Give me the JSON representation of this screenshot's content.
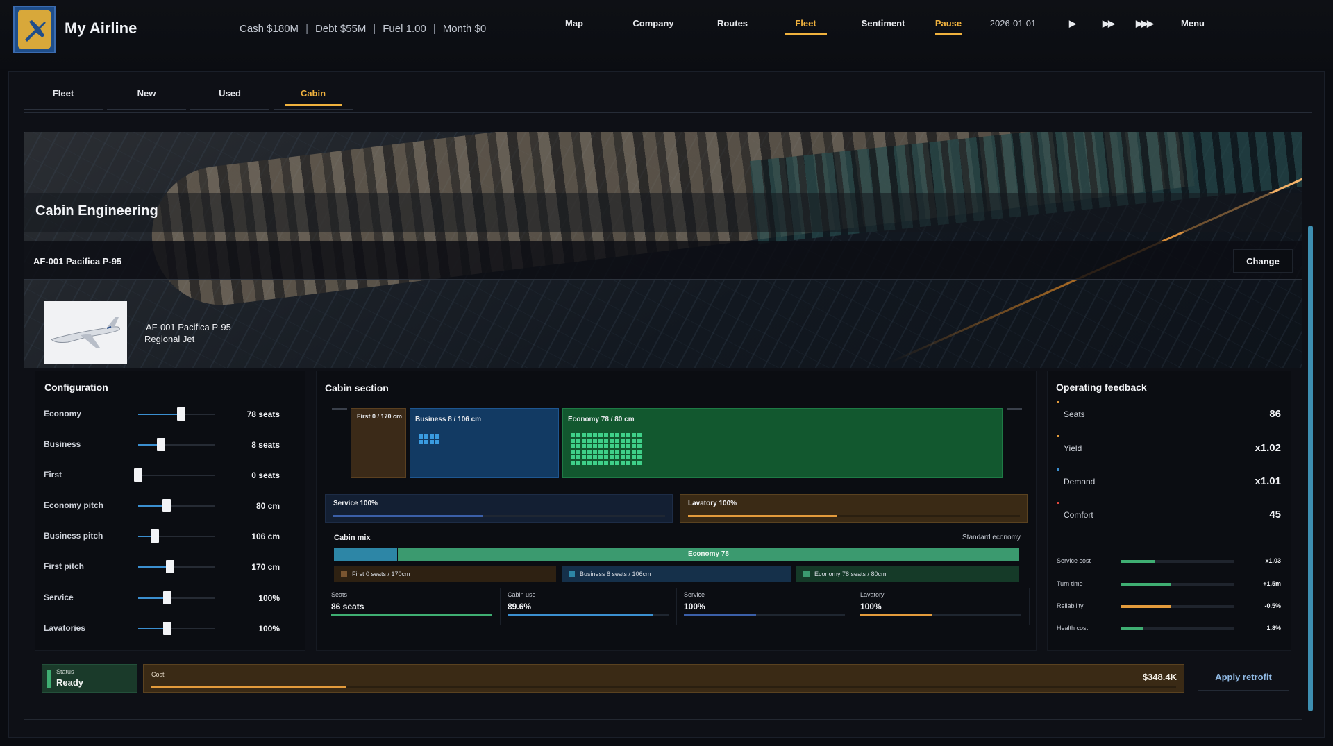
{
  "app": {
    "title": "My Airline",
    "stats": [
      "Cash $180M",
      "Debt $55M",
      "Fuel 1.00",
      "Month $0"
    ]
  },
  "topnav": {
    "map": "Map",
    "company": "Company",
    "routes": "Routes",
    "fleet": "Fleet",
    "sentiment": "Sentiment",
    "pause": "Pause",
    "date": "2026-01-01",
    "play": "▶",
    "fast": "▶▶",
    "faster": "▶▶▶",
    "menu": "Menu",
    "active": "Fleet"
  },
  "subtabs": {
    "fleet": "Fleet",
    "new": "New",
    "used": "Used",
    "cabin": "Cabin",
    "active": "Cabin"
  },
  "hero": {
    "title": "Cabin Engineering",
    "aircraft": "AF-001  Pacifica P-95",
    "change": "Change"
  },
  "aircraft": {
    "name": "AF-001  Pacifica P-95",
    "type": "Regional Jet"
  },
  "configuration": {
    "title": "Configuration",
    "rows": [
      {
        "label": "Economy",
        "value": "78 seats",
        "level": 0.56
      },
      {
        "label": "Business",
        "value": "8 seats",
        "level": 0.3
      },
      {
        "label": "First",
        "value": "0 seats",
        "level": 0.0
      },
      {
        "label": "Economy pitch",
        "value": "80 cm",
        "level": 0.37
      },
      {
        "label": "Business pitch",
        "value": "106 cm",
        "level": 0.22
      },
      {
        "label": "First pitch",
        "value": "170 cm",
        "level": 0.42
      },
      {
        "label": "Service",
        "value": "100%",
        "level": 0.38
      },
      {
        "label": "Lavatories",
        "value": "100%",
        "level": 0.38
      }
    ]
  },
  "cabin_section": {
    "title": "Cabin section",
    "first_label": "First 0 / 170 cm",
    "business_label": "Business  8  /  106 cm",
    "economy_label": "Economy  78  /  80 cm",
    "business_seats": 8,
    "economy_seats": 78,
    "service_label": "Service  100%",
    "lavatory_label": "Lavatory  100%",
    "service_level": 0.45,
    "lavatory_level": 0.45,
    "mix_title": "Cabin mix",
    "mix_note": "Standard economy",
    "mix_economy": "Economy 78",
    "legend_first": "First 0 seats  /  170cm",
    "legend_business": "Business  8 seats  /  106cm",
    "legend_economy": "Economy  78 seats  /  80cm",
    "stats": [
      {
        "label": "Seats",
        "value": "86 seats",
        "level": 1.0,
        "color": "#3fae72"
      },
      {
        "label": "Cabin use",
        "value": "89.6%",
        "level": 0.9,
        "color": "#3b8fd0"
      },
      {
        "label": "Service",
        "value": "100%",
        "level": 0.45,
        "color": "#3b5fa8"
      },
      {
        "label": "Lavatory",
        "value": "100%",
        "level": 0.45,
        "color": "#e39b3c"
      }
    ]
  },
  "feedback": {
    "title": "Operating feedback",
    "rows": [
      {
        "label": "Seats",
        "value": "86",
        "color": "#e39b3c"
      },
      {
        "label": "Yield",
        "value": "x1.02",
        "color": "#e39b3c"
      },
      {
        "label": "Demand",
        "value": "x1.01",
        "color": "#3b8fd0"
      },
      {
        "label": "Comfort",
        "value": "45",
        "color": "#e0473c"
      }
    ],
    "meters": [
      {
        "label": "Service cost",
        "value": "x1.03",
        "level": 0.3,
        "color": "#3fae72"
      },
      {
        "label": "Turn time",
        "value": "+1.5m",
        "level": 0.44,
        "color": "#3fae72"
      },
      {
        "label": "Reliability",
        "value": "-0.5%",
        "level": 0.44,
        "color": "#e39b3c"
      },
      {
        "label": "Health cost",
        "value": "1.8%",
        "level": 0.2,
        "color": "#3fae72"
      }
    ]
  },
  "footer": {
    "status_label": "Status",
    "status_value": "Ready",
    "cost_label": "Cost",
    "cost_value": "$348.4K",
    "cost_level": 0.19,
    "apply": "Apply retrofit"
  }
}
